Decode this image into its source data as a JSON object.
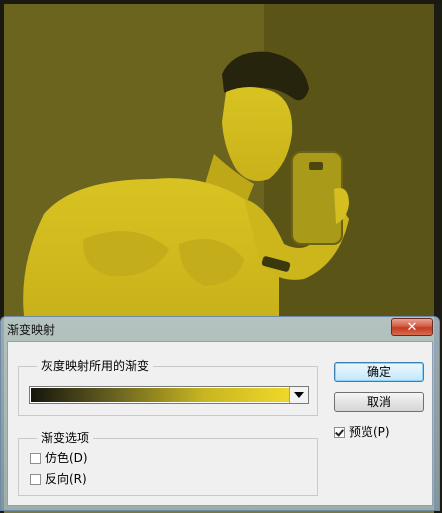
{
  "dialog": {
    "title": "渐变映射",
    "close_icon": "close-icon"
  },
  "gradient_group": {
    "label": "灰度映射所用的渐变",
    "gradient_colors": [
      "#16160e",
      "#6b6520",
      "#c8b520",
      "#f0d82a"
    ]
  },
  "options_group": {
    "label": "渐变选项",
    "dither_label": "仿色(D)",
    "dither_checked": false,
    "reverse_label": "反向(R)",
    "reverse_checked": false
  },
  "buttons": {
    "ok_label": "确定",
    "cancel_label": "取消"
  },
  "preview": {
    "label": "预览(P)",
    "checked": true
  },
  "colors": {
    "photo_tint": "#d9c21e",
    "close_button": "#c33b22",
    "default_button_border": "#3c7fb1"
  }
}
